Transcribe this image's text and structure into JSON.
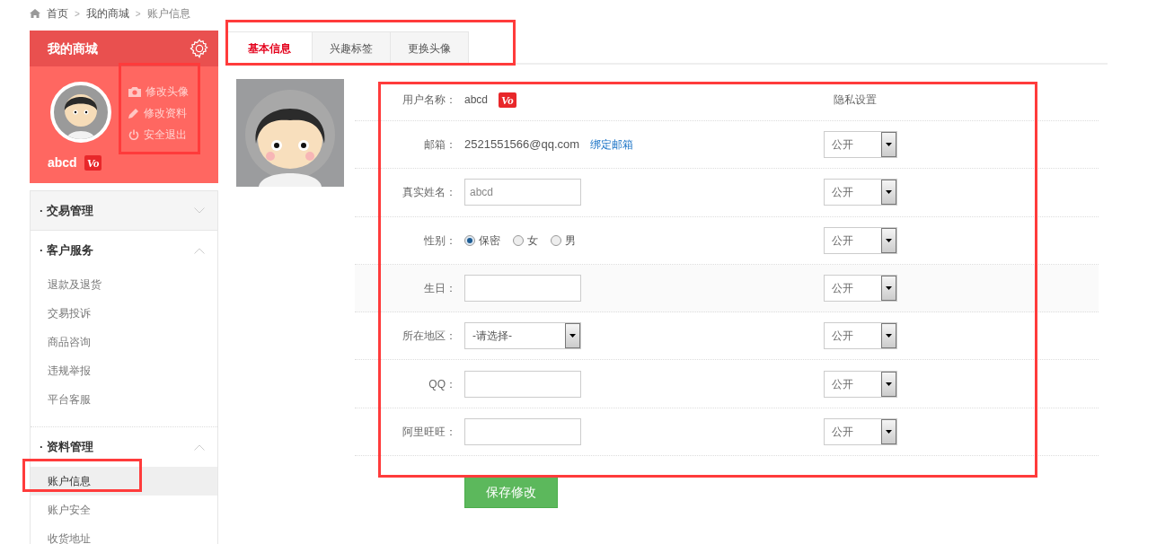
{
  "breadcrumb": [
    {
      "kind": "link",
      "text": "首页"
    },
    {
      "kind": "separator",
      "text": ">"
    },
    {
      "kind": "link",
      "text": "我的商城"
    },
    {
      "kind": "separator",
      "text": ">"
    },
    {
      "kind": "current",
      "text": "账户信息"
    }
  ],
  "sidebar": {
    "title": "我的商城",
    "profile": {
      "username": "abcd",
      "badge": "Vo",
      "actions": [
        {
          "kind": "camera",
          "label": "修改头像"
        },
        {
          "kind": "pencil",
          "label": "修改资料"
        },
        {
          "kind": "power",
          "label": "安全退出"
        }
      ]
    },
    "groups": [
      {
        "title": "· 交易管理",
        "expanded": false
      },
      {
        "title": "· 客户服务",
        "expanded": true,
        "items": [
          {
            "label": "退款及退货",
            "selected": false
          },
          {
            "label": "交易投诉",
            "selected": false
          },
          {
            "label": "商品咨询",
            "selected": false
          },
          {
            "label": "违规举报",
            "selected": false
          },
          {
            "label": "平台客服",
            "selected": false
          }
        ]
      },
      {
        "title": "· 资料管理",
        "expanded": true,
        "items": [
          {
            "label": "账户信息",
            "selected": true
          },
          {
            "label": "账户安全",
            "selected": false
          },
          {
            "label": "收货地址",
            "selected": false
          }
        ]
      }
    ]
  },
  "tabs": [
    {
      "label": "基本信息",
      "selected": true
    },
    {
      "label": "兴趣标签",
      "selected": false
    },
    {
      "label": "更换头像",
      "selected": false
    }
  ],
  "privacy_header": "隐私设置",
  "form": [
    {
      "kind": "text",
      "label": "用户名称：",
      "value": "abcd",
      "badge": "Vo"
    },
    {
      "kind": "email",
      "label": "邮箱：",
      "value": "2521551566@qq.com",
      "link": "绑定邮箱",
      "privacy": "公开"
    },
    {
      "kind": "input",
      "label": "真实姓名：",
      "placeholder": "abcd",
      "privacy": "公开"
    },
    {
      "kind": "radio",
      "label": "性别：",
      "options": [
        {
          "label": "保密",
          "selected": true
        },
        {
          "label": "女",
          "selected": false
        },
        {
          "label": "男",
          "selected": false
        }
      ],
      "privacy": "公开"
    },
    {
      "kind": "input",
      "label": "生日：",
      "privacy": "公开"
    },
    {
      "kind": "select",
      "label": "所在地区：",
      "value": "-请选择-",
      "privacy": "公开"
    },
    {
      "kind": "input",
      "label": "QQ：",
      "privacy": "公开"
    },
    {
      "kind": "input",
      "label": "阿里旺旺：",
      "privacy": "公开"
    }
  ],
  "save_button": "保存修改"
}
